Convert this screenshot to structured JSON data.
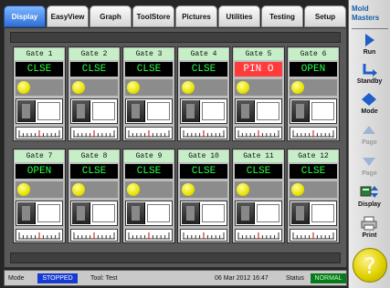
{
  "tabs": [
    "Display",
    "EasyView",
    "Graph",
    "ToolStore",
    "Pictures",
    "Utilities",
    "Testing",
    "Setup"
  ],
  "active_tab": "Display",
  "gates": [
    {
      "title": "Gate  1",
      "status": "CLSE",
      "alarm": false
    },
    {
      "title": "Gate  2",
      "status": "CLSE",
      "alarm": false
    },
    {
      "title": "Gate  3",
      "status": "CLSE",
      "alarm": false
    },
    {
      "title": "Gate  4",
      "status": "CLSE",
      "alarm": false
    },
    {
      "title": "Gate  5",
      "status": "PIN O",
      "alarm": true
    },
    {
      "title": "Gate  6",
      "status": "OPEN",
      "alarm": false
    },
    {
      "title": "Gate  7",
      "status": "OPEN",
      "alarm": false
    },
    {
      "title": "Gate  8",
      "status": "CLSE",
      "alarm": false
    },
    {
      "title": "Gate  9",
      "status": "CLSE",
      "alarm": false
    },
    {
      "title": "Gate 10",
      "status": "CLSE",
      "alarm": false
    },
    {
      "title": "Gate 11",
      "status": "CLSE",
      "alarm": false
    },
    {
      "title": "Gate 12",
      "status": "CLSE",
      "alarm": false
    }
  ],
  "statusbar": {
    "mode_label": "Mode",
    "mode_value": "STOPPED",
    "tool": "Tool: Test",
    "datetime": "06 Mar 2012 16:47",
    "status_label": "Status",
    "status_value": "NORMAL"
  },
  "sidebar": {
    "logo_line1": "Mold",
    "logo_line2": "Masters",
    "buttons": [
      {
        "label": "Run",
        "icon": "play-icon",
        "disabled": false
      },
      {
        "label": "Standby",
        "icon": "standby-icon",
        "disabled": false
      },
      {
        "label": "Mode",
        "icon": "diamond-icon",
        "disabled": false
      },
      {
        "label": "Page",
        "icon": "page-up-icon",
        "disabled": true
      },
      {
        "label": "Page",
        "icon": "page-down-icon",
        "disabled": true
      },
      {
        "label": "Display",
        "icon": "display-icon",
        "disabled": false
      },
      {
        "label": "Print",
        "icon": "print-icon",
        "disabled": false
      }
    ],
    "help_symbol": "?"
  },
  "colors": {
    "led_on": "#e9e300",
    "status_ok_text": "#2cff45",
    "status_alarm_bg": "#ff3b3b",
    "mode_bg": "#173bd1",
    "normal_bg": "#0b7a1e",
    "active_tab": "#2f6fd6"
  }
}
